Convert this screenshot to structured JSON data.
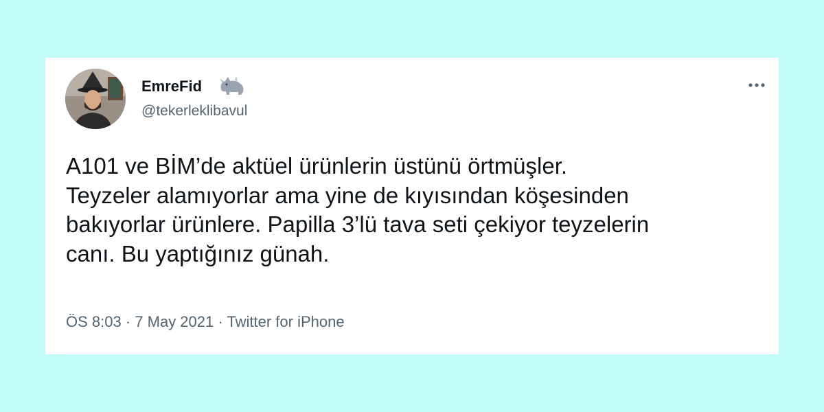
{
  "tweet": {
    "author": {
      "display_name": "EmreFid",
      "handle": "@tekerleklibavul",
      "avatar_icon": "profile-photo",
      "badge_icon": "rhinoceros-emoji"
    },
    "text": "A101 ve BİM’de aktüel ürünlerin üstünü örtmüşler.\nTeyzeler alamıyorlar ama yine de kıyısından köşesinden\nbakıyorlar ürünlere. Papilla 3’lü tava seti çekiyor teyzelerin\ncanı. Bu yaptığınız günah.",
    "time": "ÖS 8:03",
    "separator": " · ",
    "date": "7 May 2021",
    "source": "Twitter for iPhone",
    "more_icon": "more-dots-icon"
  },
  "colors": {
    "background": "#c4fbfb",
    "card": "#ffffff",
    "text_primary": "#0f1419",
    "text_secondary": "#536471"
  }
}
